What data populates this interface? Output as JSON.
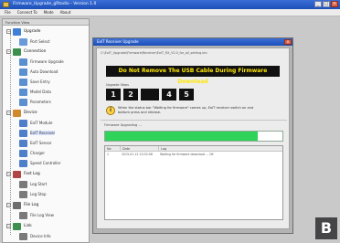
{
  "window": {
    "title": "Firmware_Upgrade_gRtodio - Version 1.0",
    "controls": [
      "_",
      "□",
      "×"
    ]
  },
  "menubar": [
    "File",
    "Connect To",
    "Mode",
    "About"
  ],
  "tree": {
    "header": "Function View",
    "items": [
      {
        "label": "Upgrade",
        "type": "group",
        "icon": "wrench-icon",
        "color": "#3f7fd6"
      },
      {
        "label": "Port Select",
        "type": "item",
        "icon": "port-icon",
        "color": "#6a9bd8"
      },
      {
        "label": "Connection",
        "type": "group",
        "icon": "link-icon",
        "color": "#3d8f4d"
      },
      {
        "label": "Firmware Upgrade",
        "type": "item",
        "icon": "chip-icon",
        "color": "#5a8fd0"
      },
      {
        "label": "Auto Download",
        "type": "item",
        "icon": "download-icon",
        "color": "#5a8fd0"
      },
      {
        "label": "Save Entry",
        "type": "item",
        "icon": "save-icon",
        "color": "#5a8fd0"
      },
      {
        "label": "Model Data",
        "type": "item",
        "icon": "database-icon",
        "color": "#5a8fd0"
      },
      {
        "label": "Parameters",
        "type": "item",
        "icon": "sliders-icon",
        "color": "#5a8fd0"
      },
      {
        "label": "Device",
        "type": "group",
        "icon": "device-icon",
        "color": "#cf8a2e"
      },
      {
        "label": "EoIT Module",
        "type": "item",
        "icon": "module-icon",
        "color": "#4f7fc8"
      },
      {
        "label": "EoIT Receiver",
        "type": "item",
        "icon": "receiver-icon",
        "color": "#4f7fc8",
        "selected": true
      },
      {
        "label": "EoIT Sensor",
        "type": "item",
        "icon": "sensor-icon",
        "color": "#4f7fc8"
      },
      {
        "label": "Charger",
        "type": "item",
        "icon": "charger-icon",
        "color": "#4f7fc8"
      },
      {
        "label": "Speed Controller",
        "type": "item",
        "icon": "esc-icon",
        "color": "#4f7fc8"
      },
      {
        "label": "Fast Log",
        "type": "group",
        "icon": "log-icon",
        "color": "#b14444"
      },
      {
        "label": "Log Start",
        "type": "item",
        "icon": "play-icon",
        "color": "#7a7a7a"
      },
      {
        "label": "Log Stop",
        "type": "item",
        "icon": "stop-icon",
        "color": "#7a7a7a"
      },
      {
        "label": "File Log",
        "type": "group",
        "icon": "file-icon",
        "color": "#6e6e6e"
      },
      {
        "label": "File Log View",
        "type": "item",
        "icon": "view-icon",
        "color": "#7a7a7a"
      },
      {
        "label": "Link",
        "type": "group",
        "icon": "link-icon",
        "color": "#3d8f4d"
      },
      {
        "label": "Device Info",
        "type": "item",
        "icon": "info-icon",
        "color": "#7a7a7a"
      }
    ]
  },
  "dialog": {
    "title": "EoIT Receiver Upgrade",
    "close": "×",
    "path": "C:\\EoIT_Upgrade\\Firmware\\Receiver\\EoIT_RX_V2.0_for_all_setting.bin",
    "banner": "Do Not Remove The USB Cable During Firmware Download",
    "steps_caption": "Upgrade Steps",
    "steps": [
      "1",
      "2",
      "",
      "4",
      "5"
    ],
    "note_icon": "info-icon",
    "note": "When the status bar \"Waiting for firmware\" comes up, EoIT receiver switch on and bottom press and release.",
    "progress_label": "Firmware Upgrading ...",
    "progress_fraction": 0.86,
    "log_columns": [
      "No",
      "Date",
      "Log"
    ],
    "log_rows": [
      [
        "1",
        "2015-01-12 10:32:08",
        "Waiting for firmware download ... OK"
      ]
    ]
  },
  "corner_label": "B",
  "colors": {
    "titlebar": "#1d4fb8",
    "banner_bg": "#111111",
    "banner_text": "#ffe600",
    "progress": "#2fd35a"
  }
}
